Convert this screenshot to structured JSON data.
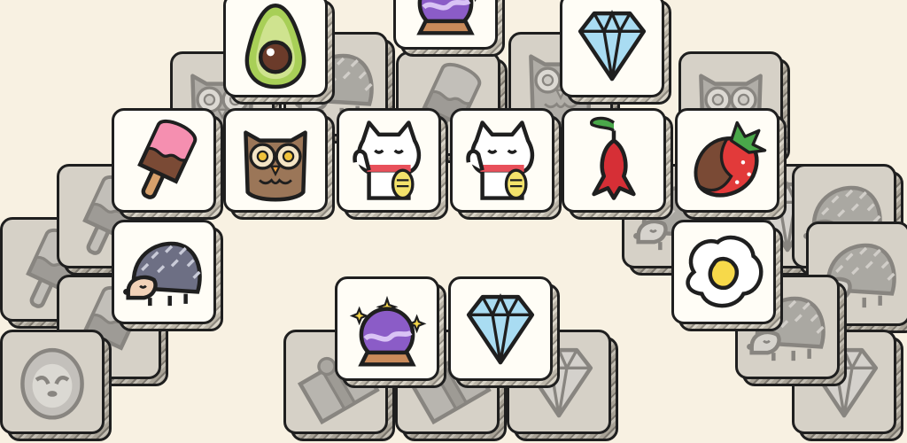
{
  "game": {
    "tiles": [
      {
        "layer": 0,
        "icon": "owl-icon"
      },
      {
        "layer": 0,
        "icon": "hedgehog-icon"
      },
      {
        "layer": 0,
        "icon": "ice-cream-bar-icon"
      },
      {
        "layer": 0,
        "icon": "ice-cream-bar-icon"
      },
      {
        "layer": 0,
        "icon": "sloth-icon"
      },
      {
        "layer": 0,
        "icon": "ice-cream-bar-icon"
      },
      {
        "layer": 0,
        "icon": "gift-box-icon"
      },
      {
        "layer": 0,
        "icon": "gift-box-icon"
      },
      {
        "layer": 0,
        "icon": "diamond-icon"
      },
      {
        "layer": 0,
        "icon": "hedgehog-icon"
      },
      {
        "layer": 0,
        "icon": "owl-icon"
      },
      {
        "layer": 0,
        "icon": "diamond-icon"
      },
      {
        "layer": 0,
        "icon": "hedgehog-icon"
      },
      {
        "layer": 0,
        "icon": "hedgehog-icon"
      },
      {
        "layer": 0,
        "icon": "diamond-icon"
      },
      {
        "layer": 0,
        "icon": "hedgehog-icon"
      },
      {
        "layer": 0,
        "icon": "owl-icon"
      },
      {
        "layer": 0,
        "icon": "ice-cream-bar-icon"
      },
      {
        "layer": 1,
        "icon": "avocado-icon"
      },
      {
        "layer": 1,
        "icon": "crystal-ball-icon"
      },
      {
        "layer": 1,
        "icon": "diamond-icon"
      },
      {
        "layer": 1,
        "icon": "ice-cream-bar-icon"
      },
      {
        "layer": 1,
        "icon": "owl-icon"
      },
      {
        "layer": 1,
        "icon": "lucky-cat-icon"
      },
      {
        "layer": 1,
        "icon": "lucky-cat-icon"
      },
      {
        "layer": 1,
        "icon": "red-flower-icon"
      },
      {
        "layer": 1,
        "icon": "chocolate-strawberry-icon"
      },
      {
        "layer": 1,
        "icon": "hedgehog-icon"
      },
      {
        "layer": 1,
        "icon": "fried-egg-icon"
      },
      {
        "layer": 1,
        "icon": "crystal-ball-icon"
      },
      {
        "layer": 1,
        "icon": "diamond-icon"
      }
    ],
    "colors": {
      "background": "#f8f1e2",
      "tile_face": "#fffdf6",
      "tile_outline": "#1f1f1f",
      "avocado": "#a8cf57",
      "crystal_ball": "#8b5cc7",
      "diamond": "#a9dcf2",
      "ice_cream_pink": "#f58fb0",
      "chocolate": "#7a4a35",
      "owl": "#9b7658",
      "lucky_cat_collar": "#e8505b",
      "lucky_cat_coin": "#f3e26b",
      "flower": "#d62f36",
      "strawberry": "#e23a3a",
      "leaf": "#4aa84a",
      "hedgehog": "#6d6f84",
      "egg_yolk": "#f7d94a"
    }
  }
}
